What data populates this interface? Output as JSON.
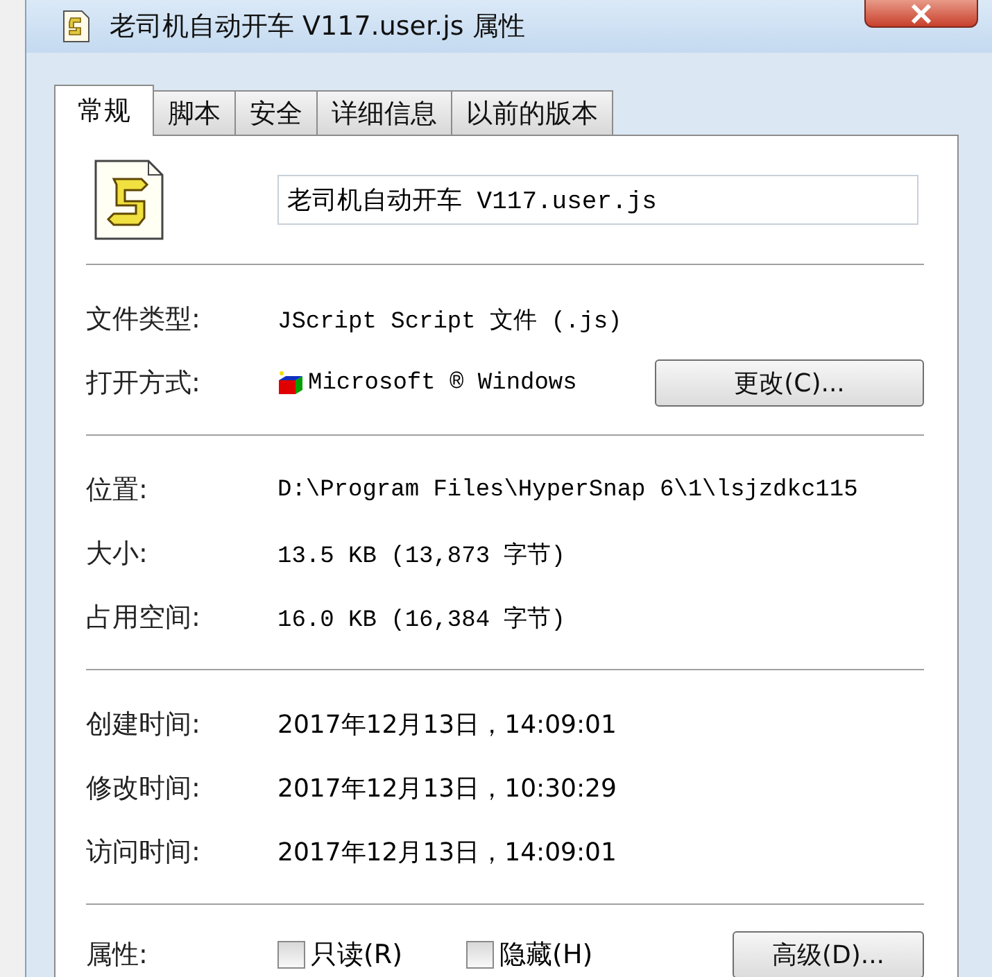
{
  "window": {
    "title": "老司机自动开车 V117.user.js 属性"
  },
  "tabs": [
    {
      "label": "常规",
      "selected": true
    },
    {
      "label": "脚本",
      "selected": false
    },
    {
      "label": "安全",
      "selected": false
    },
    {
      "label": "详细信息",
      "selected": false
    },
    {
      "label": "以前的版本",
      "selected": false
    }
  ],
  "file_name": {
    "value": "老司机自动开车 V117.user.js"
  },
  "sections": [
    {
      "rows": [
        {
          "kind": "text",
          "label": "文件类型:",
          "value": "JScript Script 文件 (.js)"
        },
        {
          "kind": "app",
          "label": "打开方式:",
          "value": "Microsoft ® Windows",
          "button": "更改(C)..."
        }
      ]
    },
    {
      "rows": [
        {
          "kind": "text",
          "label": "位置:",
          "value": "D:\\Program Files\\HyperSnap 6\\1\\lsjzdkc115"
        },
        {
          "kind": "text",
          "label": "大小:",
          "value": "13.5 KB (13,873 字节)"
        },
        {
          "kind": "text",
          "label": "占用空间:",
          "value": "16.0 KB (16,384 字节)"
        }
      ]
    },
    {
      "rows": [
        {
          "kind": "date",
          "label": "创建时间:",
          "value": "2017年12月13日，14:09:01"
        },
        {
          "kind": "date",
          "label": "修改时间:",
          "value": "2017年12月13日，10:30:29"
        },
        {
          "kind": "date",
          "label": "访问时间:",
          "value": "2017年12月13日，14:09:01"
        }
      ]
    }
  ],
  "attributes": {
    "label": "属性:",
    "checkboxes": [
      {
        "label": "只读(R)",
        "checked": false
      },
      {
        "label": "隐藏(H)",
        "checked": false
      }
    ],
    "button": "高级(D)..."
  }
}
